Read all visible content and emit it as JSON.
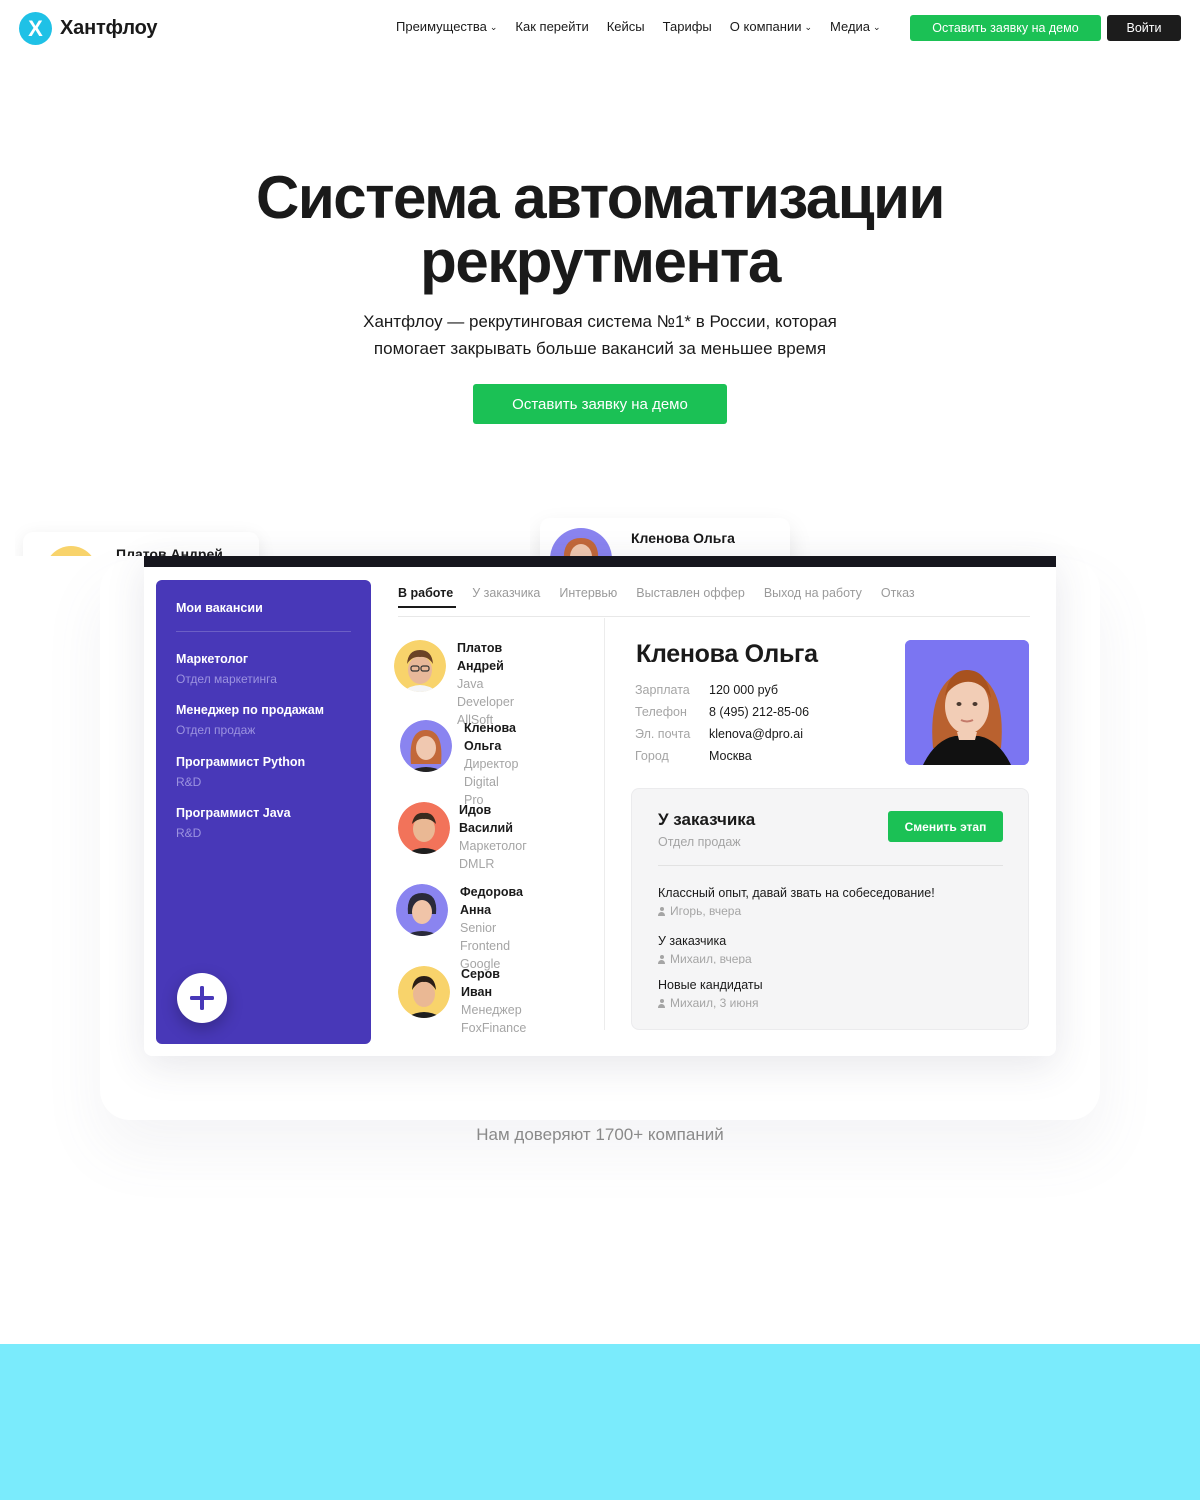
{
  "header": {
    "logo_text": "Хантфлоу",
    "logo_letter": "X",
    "nav": [
      {
        "label": "Преимущества",
        "has_dropdown": true
      },
      {
        "label": "Как перейти",
        "has_dropdown": false
      },
      {
        "label": "Кейсы",
        "has_dropdown": false
      },
      {
        "label": "Тарифы",
        "has_dropdown": false
      },
      {
        "label": "О компании",
        "has_dropdown": true
      },
      {
        "label": "Медиа",
        "has_dropdown": true
      }
    ],
    "demo_button": "Оставить заявку на демо",
    "login_button": "Войти"
  },
  "hero": {
    "title_line1": "Система автоматизации",
    "title_line2": "рекрутмента",
    "subtitle_line1": "Хантфлоу — рекрутинговая система №1* в России, которая",
    "subtitle_line2": "помогает закрывать больше вакансий за меньшее время",
    "cta": "Оставить заявку на демо"
  },
  "peek_cards": {
    "left_name": "Платов Андрей",
    "right_name": "Кленова Ольга"
  },
  "app": {
    "sidebar": {
      "title": "Мои вакансии",
      "items": [
        {
          "name": "Маркетолог",
          "dept": "Отдел маркетинга"
        },
        {
          "name": "Менеджер по продажам",
          "dept": "Отдел продаж"
        },
        {
          "name": "Программист Python",
          "dept": "R&D"
        },
        {
          "name": "Программист Java",
          "dept": "R&D"
        }
      ]
    },
    "tabs": [
      "В работе",
      "У заказчика",
      "Интервью",
      "Выставлен оффер",
      "Выход на работу",
      "Отказ"
    ],
    "candidates": [
      {
        "name": "Платов Андрей",
        "role": "Java Developer",
        "company": "AllSoft",
        "bg": "#f8d36b"
      },
      {
        "name": "Кленова Ольга",
        "role": "Директор",
        "company": "Digital Pro",
        "bg": "#8a84f0"
      },
      {
        "name": "Идов Василий",
        "role": "Маркетолог",
        "company": "DMLR",
        "bg": "#f2735a"
      },
      {
        "name": "Федорова Анна",
        "role": "Senior Frontend",
        "company": "Google",
        "bg": "#8a84f0"
      },
      {
        "name": "Серов Иван",
        "role": "Менеджер",
        "company": "FoxFinance",
        "bg": "#f8d36b"
      }
    ],
    "profile": {
      "name": "Кленова Ольга",
      "fields": [
        {
          "key": "Зарплата",
          "value": "120 000 руб"
        },
        {
          "key": "Телефон",
          "value": "8 (495) 212-85-06"
        },
        {
          "key": "Эл. почта",
          "value": "klenova@dpro.ai"
        },
        {
          "key": "Город",
          "value": "Москва"
        }
      ]
    },
    "stage": {
      "title": "У заказчика",
      "dept": "Отдел продаж",
      "button": "Сменить этап",
      "comments": [
        {
          "text": "Классный опыт, давай звать на собеседование!",
          "meta": "Игорь, вчера"
        },
        {
          "text": "У заказчика",
          "meta": "Михаил, вчера"
        },
        {
          "text": "Новые кандидаты",
          "meta": "Михаил, 3 июня"
        }
      ]
    }
  },
  "trust_text": "Нам доверяют 1700+ компаний",
  "colors": {
    "brand_green": "#1bc155",
    "sidebar_purple": "#4838b8",
    "logo_cyan": "#1fc1e6",
    "band_cyan": "#7aebfc"
  }
}
